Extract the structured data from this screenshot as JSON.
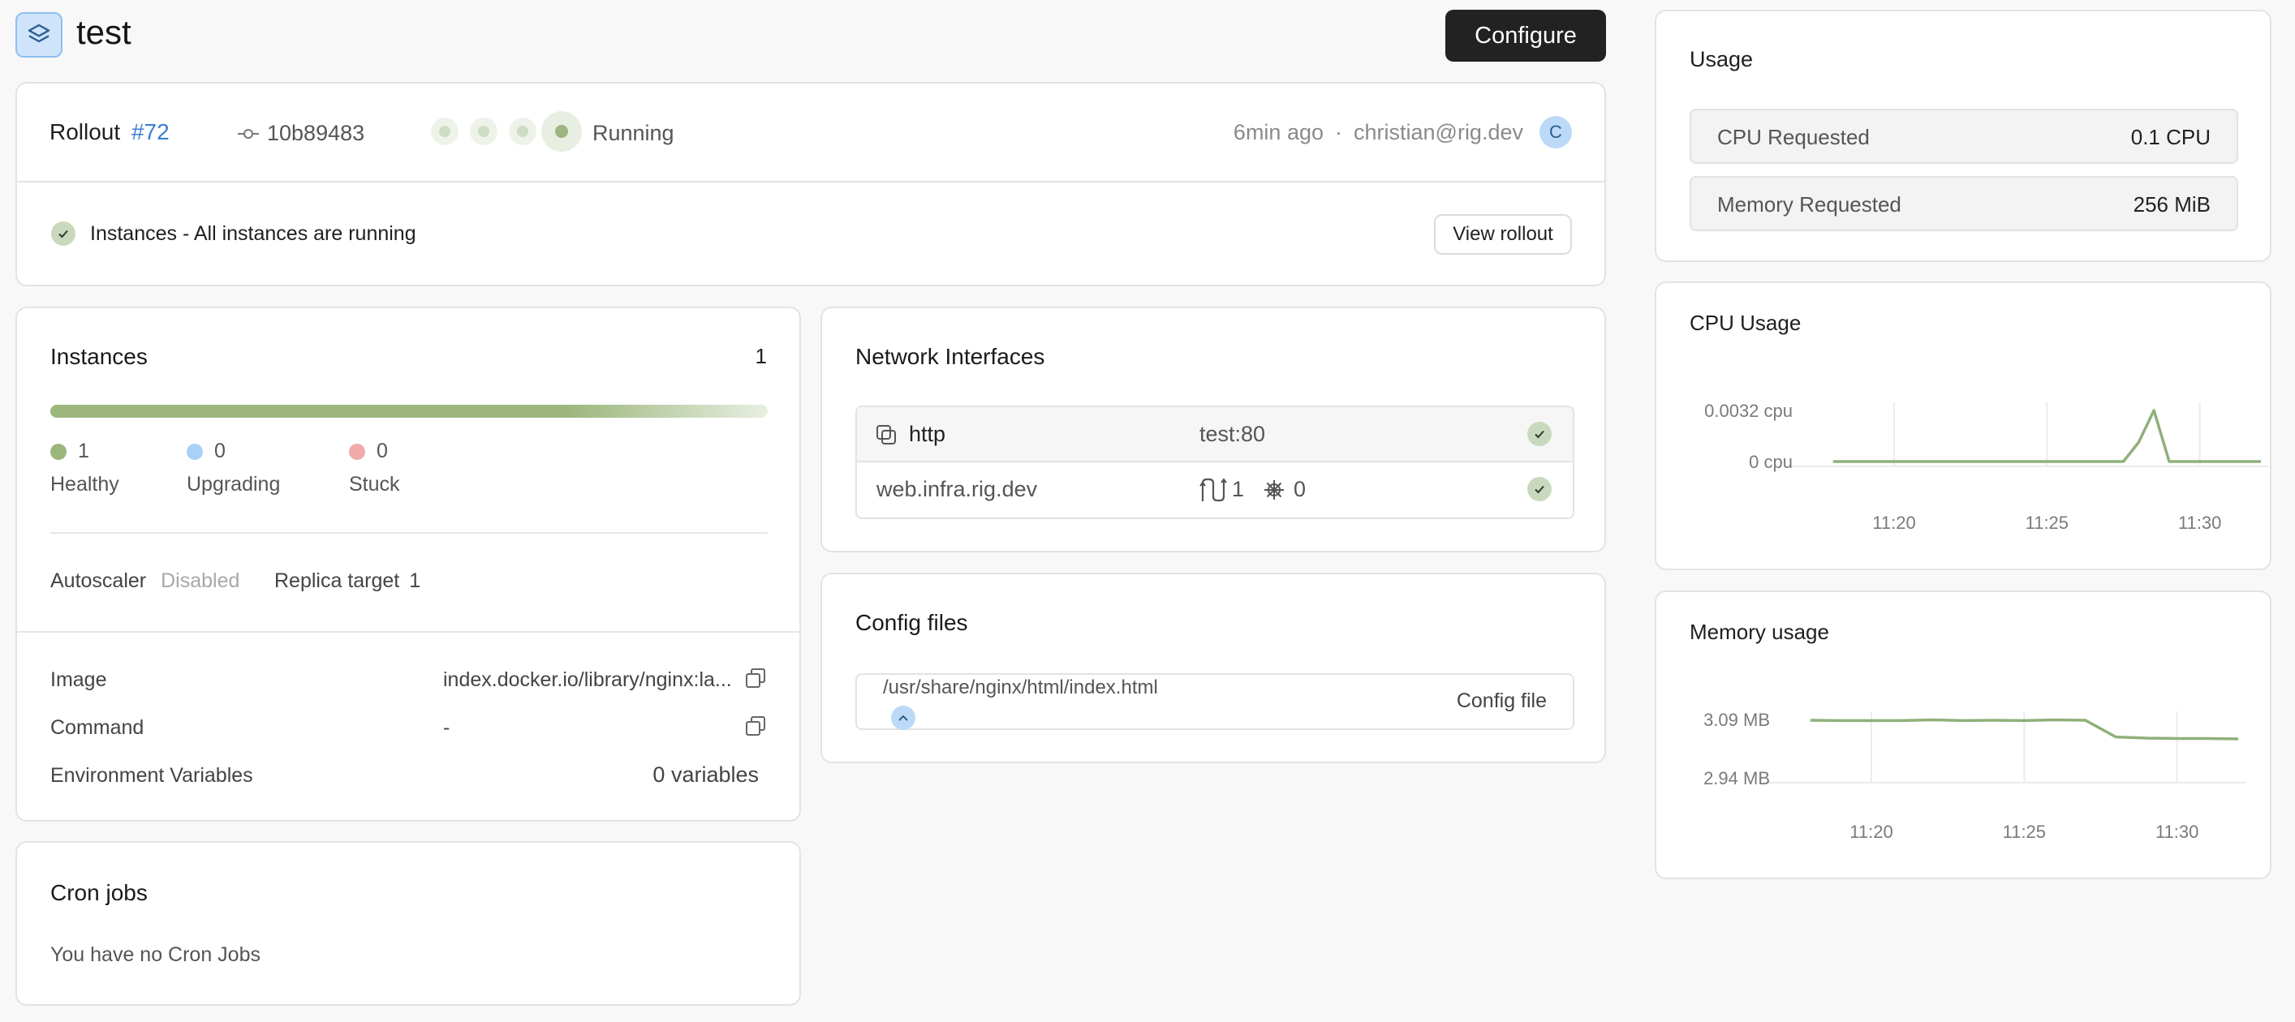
{
  "header": {
    "title": "test",
    "configure_label": "Configure"
  },
  "rollout": {
    "label": "Rollout",
    "number": "#72",
    "commit": "10b89483",
    "status": "Running",
    "time_ago": "6min ago",
    "separator": "·",
    "user": "christian@rig.dev",
    "avatar_initial": "C",
    "instances_message": "Instances - All instances are running",
    "view_rollout_label": "View rollout"
  },
  "instances": {
    "title": "Instances",
    "count": "1",
    "legend": [
      {
        "value": "1",
        "label": "Healthy",
        "color": "#9cb67d"
      },
      {
        "value": "0",
        "label": "Upgrading",
        "color": "#a9d0f5"
      },
      {
        "value": "0",
        "label": "Stuck",
        "color": "#f2a9a9"
      }
    ],
    "autoscaler_label": "Autoscaler",
    "autoscaler_value": "Disabled",
    "replica_label": "Replica target",
    "replica_value": "1",
    "image_label": "Image",
    "image_value": "index.docker.io/library/nginx:la...",
    "command_label": "Command",
    "command_value": "-",
    "env_label": "Environment Variables",
    "env_value": "0 variables"
  },
  "network": {
    "title": "Network Interfaces",
    "interface_name": "http",
    "interface_target": "test:80",
    "ingress_host": "web.infra.rig.dev",
    "route_count": "1",
    "gear_count": "0"
  },
  "config": {
    "title": "Config files",
    "path": "/usr/share/nginx/html/index.html",
    "type_label": "Config file"
  },
  "cron": {
    "title": "Cron jobs",
    "empty_message": "You have no Cron Jobs"
  },
  "usage": {
    "title": "Usage",
    "cpu_label": "CPU Requested",
    "cpu_value": "0.1 CPU",
    "memory_label": "Memory Requested",
    "memory_value": "256 MiB"
  },
  "chart_data": [
    {
      "type": "line",
      "title": "CPU Usage",
      "y_ticks": [
        "0.0032 cpu",
        "0 cpu"
      ],
      "x_ticks": [
        "11:20",
        "11:25",
        "11:30"
      ],
      "color": "#8fb07a",
      "x": [
        "11:18",
        "11:20",
        "11:22",
        "11:24",
        "11:26",
        "11:27:30",
        "11:28",
        "11:28:30",
        "11:29",
        "11:30",
        "11:32"
      ],
      "values": [
        0,
        0,
        0,
        0,
        0,
        0,
        0.0012,
        0.0032,
        0,
        0,
        0
      ],
      "ylim": [
        0,
        0.0032
      ]
    },
    {
      "type": "line",
      "title": "Memory usage",
      "y_ticks": [
        "3.09 MB",
        "2.94 MB"
      ],
      "x_ticks": [
        "11:20",
        "11:25",
        "11:30"
      ],
      "color": "#8fb07a",
      "x": [
        "11:18",
        "11:19",
        "11:20",
        "11:21",
        "11:22",
        "11:23",
        "11:24",
        "11:25",
        "11:26",
        "11:27",
        "11:28",
        "11:29",
        "11:30",
        "11:31",
        "11:32"
      ],
      "values": [
        3.088,
        3.087,
        3.087,
        3.087,
        3.089,
        3.087,
        3.088,
        3.087,
        3.089,
        3.088,
        3.045,
        3.042,
        3.041,
        3.041,
        3.04
      ],
      "ylim": [
        2.94,
        3.09
      ]
    }
  ]
}
